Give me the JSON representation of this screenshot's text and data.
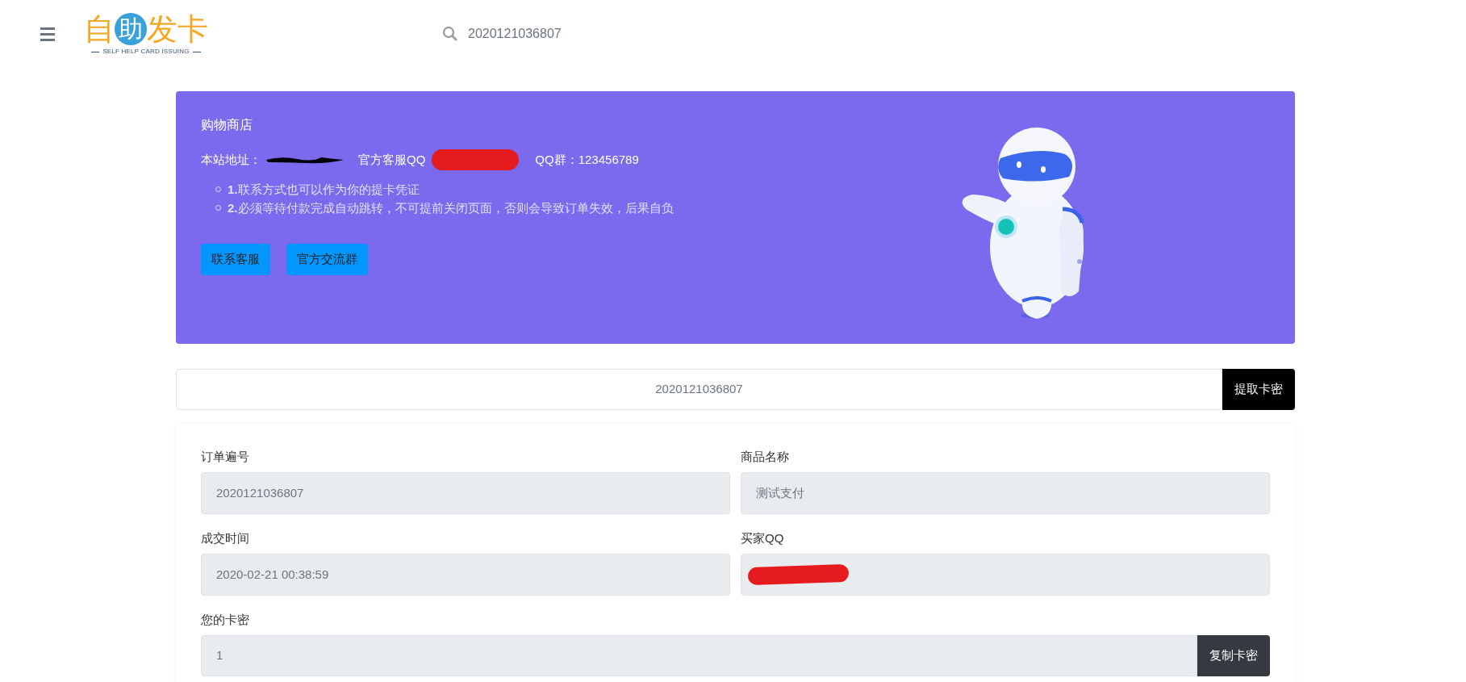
{
  "header": {
    "logo": {
      "title": "自助发卡",
      "tagline": "SELF HELP CARD ISSUING"
    },
    "search": {
      "value": "2020121036807"
    }
  },
  "banner": {
    "title": "购物商店",
    "info": [
      {
        "label": "本站地址：",
        "kind": "scribble"
      },
      {
        "label": "官方客服QQ",
        "kind": "blob"
      },
      {
        "label": "QQ群：123456789",
        "kind": "plain"
      }
    ],
    "notes": [
      "**1.**联系方式也可以作为你的提卡凭证",
      "**2.**必须等待付款完成自动跳转，不可提前关闭页面，否则会导致订单失效，后果自负"
    ],
    "buttons": [
      "联系客服",
      "官方交流群"
    ]
  },
  "lookup": {
    "value": "2020121036807",
    "button": "提取卡密"
  },
  "order": {
    "fields": [
      {
        "label": "订单遍号",
        "value": "2020121036807",
        "redacted": false
      },
      {
        "label": "商品名称",
        "value": "测试支付",
        "redacted": false
      },
      {
        "label": "成交时间",
        "value": "2020-02-21 00:38:59",
        "redacted": false
      },
      {
        "label": "买家QQ",
        "redacted": true
      }
    ],
    "card": {
      "label": "您的卡密",
      "value": "1",
      "button": "复制卡密"
    }
  }
}
